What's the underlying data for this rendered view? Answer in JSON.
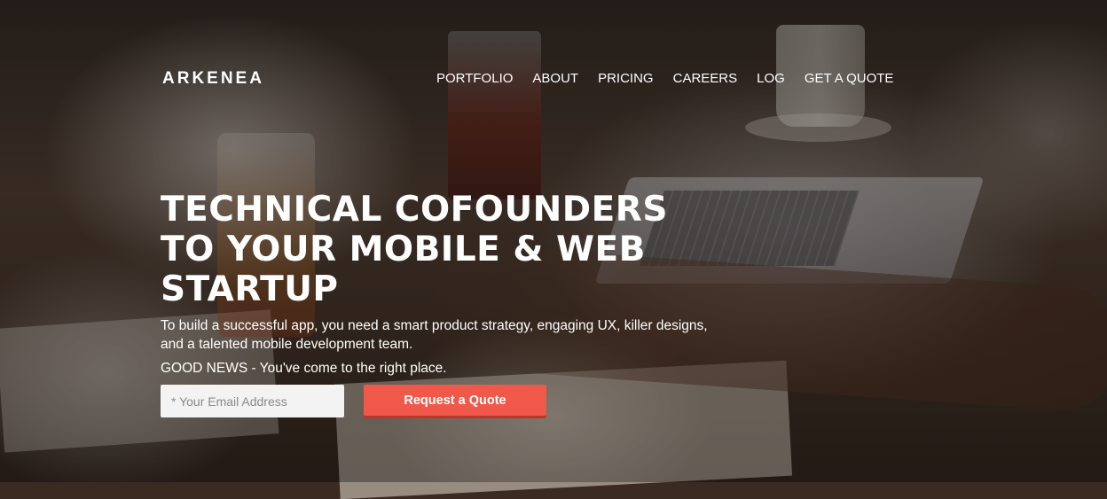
{
  "brand": {
    "logo_text": "ARKENEA"
  },
  "nav": {
    "items": [
      {
        "label": "PORTFOLIO"
      },
      {
        "label": "ABOUT"
      },
      {
        "label": "PRICING"
      },
      {
        "label": "CAREERS"
      },
      {
        "label": "LOG"
      },
      {
        "label": "GET A QUOTE"
      }
    ]
  },
  "hero": {
    "headline_lines": [
      "TECHNICAL COFOUNDERS",
      "TO YOUR MOBILE & WEB",
      "STARTUP"
    ],
    "subtext": "To build a successful app, you need a smart product strategy, engaging UX, killer designs, and a talented mobile development team.",
    "good_news_label": "GOOD NEWS",
    "good_news_text": " - You've come to the right place."
  },
  "form": {
    "email_placeholder": "* Your Email Address",
    "email_value": "",
    "submit_label": "Request a Quote"
  },
  "colors": {
    "accent": "#f0594a",
    "input_bg": "#f3f3f3",
    "text": "#ffffff"
  }
}
